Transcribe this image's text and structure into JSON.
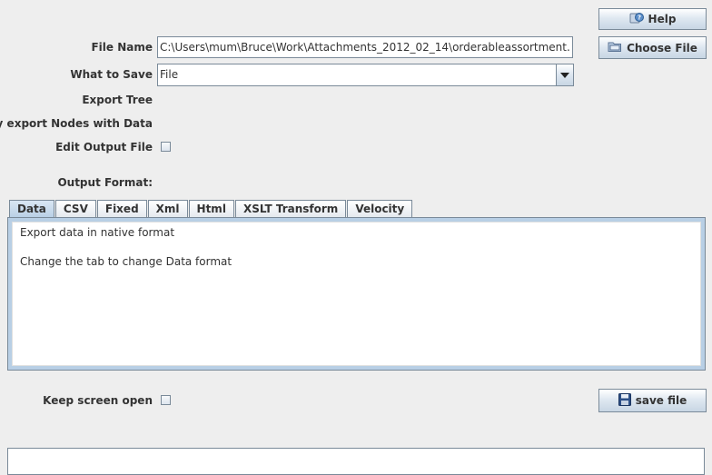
{
  "form": {
    "file_name_label": "File Name",
    "file_name_value": "C:\\Users\\mum\\Bruce\\Work\\Attachments_2012_02_14\\orderableassortment.xsl$",
    "what_to_save_label": "What to Save",
    "what_to_save_value": "File",
    "export_tree_label": "Export Tree",
    "only_export_label": "Only export Nodes with Data",
    "edit_output_label": "Edit Output File",
    "output_format_label": "Output Format:"
  },
  "buttons": {
    "help": "Help",
    "choose_file": "Choose File",
    "save_file": "save file"
  },
  "tabs": [
    "Data",
    "CSV",
    "Fixed",
    "Xml",
    "Html",
    "XSLT Transform",
    "Velocity"
  ],
  "active_tab": "Data",
  "panel": {
    "line1": "Export data in native format",
    "line2": "Change the tab to change Data format"
  },
  "footer": {
    "keep_open_label": "Keep screen open"
  },
  "icons": {
    "help": "help-icon",
    "choose_file": "folder-icon",
    "save_file": "floppy-disk-icon"
  }
}
